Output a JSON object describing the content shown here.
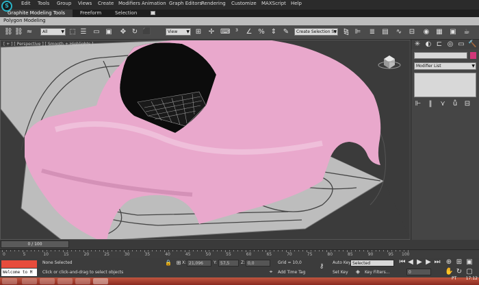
{
  "menu": [
    "Edit",
    "Tools",
    "Group",
    "Views",
    "Create",
    "Modifiers",
    "Animation",
    "Graph Editors",
    "Rendering",
    "Customize",
    "MAXScript",
    "Help"
  ],
  "ribbon_tabs": [
    "Graphite Modeling Tools",
    "Freeform",
    "Selection"
  ],
  "subribbon_label": "Polygon Modeling",
  "toolbar": {
    "filter": "All",
    "ref_coord": "View",
    "named_selection": "Create Selection Se"
  },
  "viewport": {
    "label": "[ + ] [ Perspective ] [ Smooth + Highlights ]",
    "car_color": "#e9a8cc",
    "bg_color": "#3b3b3b"
  },
  "command_panel": {
    "modifier_list": "Modifier List",
    "object_color": "#d3377a"
  },
  "timeline": {
    "slider": "0 / 100",
    "ticks": [
      "0",
      "5",
      "10",
      "15",
      "20",
      "25",
      "30",
      "35",
      "40",
      "45",
      "50",
      "55",
      "60",
      "65",
      "70",
      "75",
      "80",
      "85",
      "90",
      "95",
      "100"
    ]
  },
  "status": {
    "selection": "None Selected",
    "prompt": "Click or click-and-drag to select objects",
    "x_label": "X:",
    "x": "21,096",
    "y_label": "Y:",
    "y": "57,5",
    "z_label": "Z:",
    "z": "0,0",
    "grid": "Grid = 10,0",
    "add_time_tag": "Add Time Tag",
    "auto_key": "Auto Key",
    "set_key": "Set Key",
    "key_mode": "Selected",
    "key_filters": "Key Filters...",
    "frame": "0",
    "welcome": "Welcome to M"
  },
  "taskbar": {
    "lang": "PT",
    "clock": "17:12"
  }
}
